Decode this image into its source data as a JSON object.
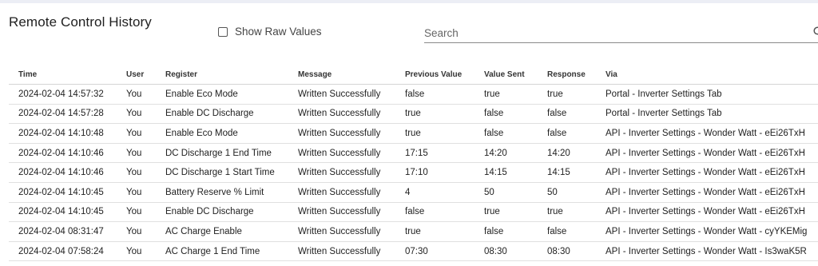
{
  "page": {
    "title": "Remote Control History"
  },
  "filters": {
    "raw_label": "Show Raw Values",
    "raw_checked": false
  },
  "search": {
    "placeholder": "Search",
    "value": ""
  },
  "table": {
    "headers": [
      "Time",
      "User",
      "Register",
      "Message",
      "Previous Value",
      "Value Sent",
      "Response",
      "Via"
    ],
    "rows": [
      [
        "2024-02-04 14:57:32",
        "You",
        "Enable Eco Mode",
        "Written Successfully",
        "false",
        "true",
        "true",
        "Portal - Inverter Settings Tab"
      ],
      [
        "2024-02-04 14:57:28",
        "You",
        "Enable DC Discharge",
        "Written Successfully",
        "true",
        "false",
        "false",
        "Portal - Inverter Settings Tab"
      ],
      [
        "2024-02-04 14:10:48",
        "You",
        "Enable Eco Mode",
        "Written Successfully",
        "true",
        "false",
        "false",
        "API - Inverter Settings - Wonder Watt - eEi26TxH"
      ],
      [
        "2024-02-04 14:10:46",
        "You",
        "DC Discharge 1 End Time",
        "Written Successfully",
        "17:15",
        "14:20",
        "14:20",
        "API - Inverter Settings - Wonder Watt - eEi26TxH"
      ],
      [
        "2024-02-04 14:10:46",
        "You",
        "DC Discharge 1 Start Time",
        "Written Successfully",
        "17:10",
        "14:15",
        "14:15",
        "API - Inverter Settings - Wonder Watt - eEi26TxH"
      ],
      [
        "2024-02-04 14:10:45",
        "You",
        "Battery Reserve % Limit",
        "Written Successfully",
        "4",
        "50",
        "50",
        "API - Inverter Settings - Wonder Watt - eEi26TxH"
      ],
      [
        "2024-02-04 14:10:45",
        "You",
        "Enable DC Discharge",
        "Written Successfully",
        "false",
        "true",
        "true",
        "API - Inverter Settings - Wonder Watt - eEi26TxH"
      ],
      [
        "2024-02-04 08:31:47",
        "You",
        "AC Charge Enable",
        "Written Successfully",
        "true",
        "false",
        "false",
        "API - Inverter Settings - Wonder Watt - cyYKEMig"
      ],
      [
        "2024-02-04 07:58:24",
        "You",
        "AC Charge 1 End Time",
        "Written Successfully",
        "07:30",
        "08:30",
        "08:30",
        "API - Inverter Settings - Wonder Watt - Is3waK5R"
      ]
    ]
  },
  "colors": {
    "background": "#ffffff",
    "text": "#222222",
    "top_strip": "#eceef5",
    "row_divider": "#e0e0e0"
  }
}
